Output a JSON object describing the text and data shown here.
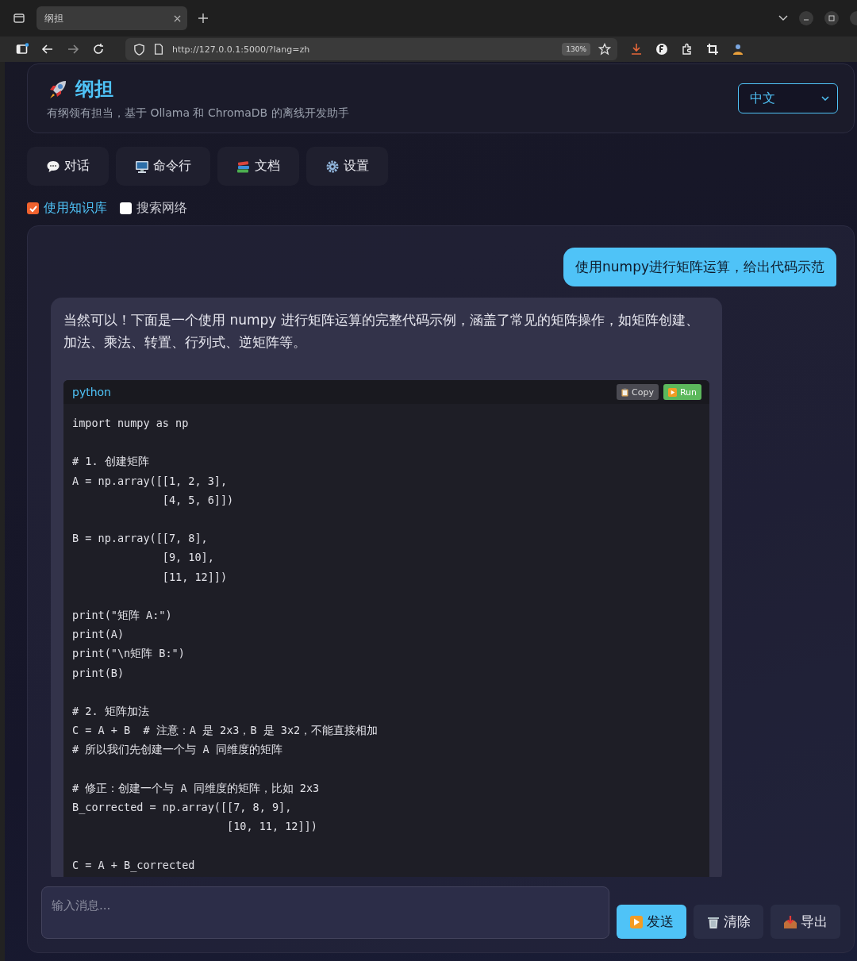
{
  "browser": {
    "tab_title": "纲担",
    "url": "http://127.0.0.1:5000/?lang=zh",
    "zoom": "130%"
  },
  "header": {
    "title": "纲担",
    "subtitle": "有纲领有担当，基于 Ollama 和 ChromaDB 的离线开发助手",
    "language": "中文"
  },
  "nav": [
    {
      "label": "对话",
      "kind": "chat"
    },
    {
      "label": "命令行",
      "kind": "terminal"
    },
    {
      "label": "文档",
      "kind": "docs"
    },
    {
      "label": "设置",
      "kind": "settings"
    }
  ],
  "options": [
    {
      "label": "使用知识库",
      "checked": true
    },
    {
      "label": "搜索网络",
      "checked": false
    }
  ],
  "messages": [
    {
      "kind": "user",
      "text": "使用numpy进行矩阵运算，给出代码示范"
    },
    {
      "kind": "assistant",
      "text": "当然可以！下面是一个使用 numpy 进行矩阵运算的完整代码示例，涵盖了常见的矩阵操作，如矩阵创建、加法、乘法、转置、行列式、逆矩阵等。",
      "code": {
        "language": "python",
        "copy": "Copy",
        "run": "Run",
        "text": "import numpy as np\n\n# 1. 创建矩阵\nA = np.array([[1, 2, 3],\n              [4, 5, 6]])\n\nB = np.array([[7, 8],\n              [9, 10],\n              [11, 12]])\n\nprint(\"矩阵 A:\")\nprint(A)\nprint(\"\\n矩阵 B:\")\nprint(B)\n\n# 2. 矩阵加法\nC = A + B  # 注意：A 是 2x3，B 是 3x2，不能直接相加\n# 所以我们先创建一个与 A 同维度的矩阵\n\n# 修正：创建一个与 A 同维度的矩阵，比如 2x3\nB_corrected = np.array([[7, 8, 9],\n                        [10, 11, 12]])\n\nC = A + B_corrected"
      }
    }
  ],
  "input": {
    "placeholder": "输入消息..."
  },
  "actions": [
    {
      "label": "发送",
      "kind": "send"
    },
    {
      "label": "清除",
      "kind": "clear"
    },
    {
      "label": "导出",
      "kind": "export"
    }
  ]
}
